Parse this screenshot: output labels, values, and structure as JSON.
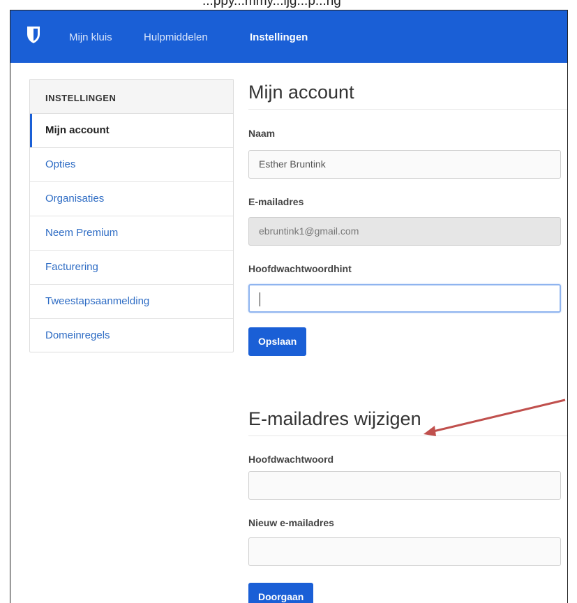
{
  "top_cut_text": "...ppy...mmy...ijg...p...ng",
  "nav": {
    "items": [
      {
        "label": "Mijn kluis"
      },
      {
        "label": "Hulpmiddelen"
      },
      {
        "label": "Instellingen"
      }
    ],
    "brand_color": "#1a5fd6"
  },
  "sidebar": {
    "heading": "INSTELLINGEN",
    "items": [
      {
        "label": "Mijn account"
      },
      {
        "label": "Opties"
      },
      {
        "label": "Organisaties"
      },
      {
        "label": "Neem Premium"
      },
      {
        "label": "Facturering"
      },
      {
        "label": "Tweestapsaanmelding"
      },
      {
        "label": "Domeinregels"
      }
    ]
  },
  "account": {
    "title": "Mijn account",
    "name_label": "Naam",
    "name_value": "Esther Bruntink",
    "email_label": "E-mailadres",
    "email_value": "ebruntink1@gmail.com",
    "hint_label": "Hoofdwachtwoordhint",
    "hint_value": "",
    "save_label": "Opslaan"
  },
  "change_email": {
    "title": "E-mailadres wijzigen",
    "password_label": "Hoofdwachtwoord",
    "password_value": "",
    "new_email_label": "Nieuw e-mailadres",
    "new_email_value": "",
    "continue_label": "Doorgaan"
  },
  "annotation": {
    "color": "#c0504d"
  }
}
